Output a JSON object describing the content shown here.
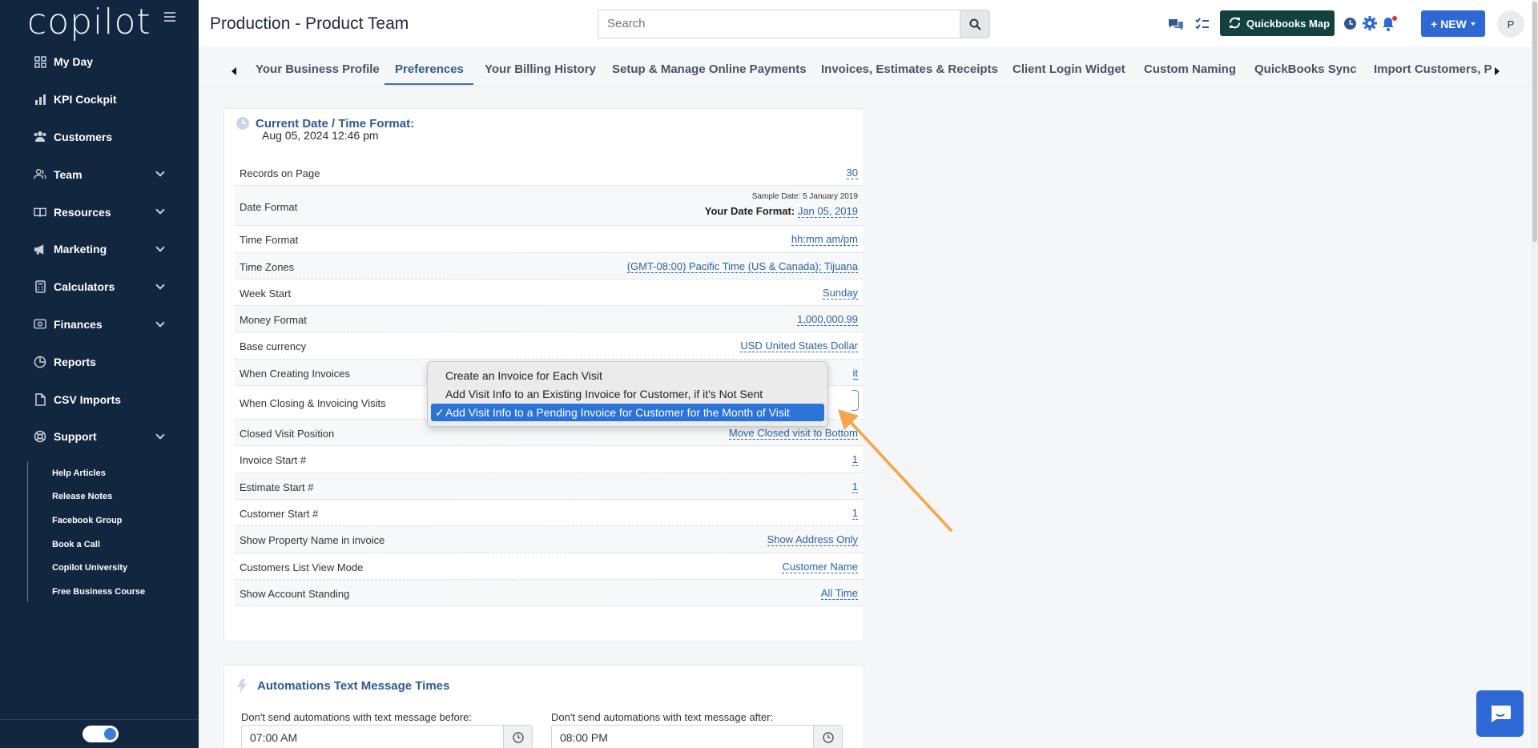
{
  "app": {
    "logo": "copilot"
  },
  "sidebar": {
    "items": [
      {
        "label": "My Day",
        "icon": "grid-icon"
      },
      {
        "label": "KPI Cockpit",
        "icon": "bar-chart-icon"
      },
      {
        "label": "Customers",
        "icon": "users-icon"
      },
      {
        "label": "Team",
        "icon": "user-group-icon",
        "expandable": true
      },
      {
        "label": "Resources",
        "icon": "book-icon",
        "expandable": true
      },
      {
        "label": "Marketing",
        "icon": "megaphone-icon",
        "expandable": true
      },
      {
        "label": "Calculators",
        "icon": "calculator-icon",
        "expandable": true
      },
      {
        "label": "Finances",
        "icon": "money-icon",
        "expandable": true
      },
      {
        "label": "Reports",
        "icon": "pie-chart-icon"
      },
      {
        "label": "CSV Imports",
        "icon": "file-icon"
      },
      {
        "label": "Support",
        "icon": "lifebuoy-icon",
        "expandable": true
      }
    ],
    "support_items": [
      "Help Articles",
      "Release Notes",
      "Facebook Group",
      "Book a Call",
      "Copilot University",
      "Free Business Course"
    ]
  },
  "header": {
    "title": "Production - Product Team",
    "search_placeholder": "Search",
    "quickbooks_label": "Quickbooks Map",
    "new_label": "+ NEW",
    "avatar_initial": "P"
  },
  "tabs": [
    "Your Business Profile",
    "Preferences",
    "Your Billing History",
    "Setup & Manage Online Payments",
    "Invoices, Estimates & Receipts",
    "Client Login Widget",
    "Custom Naming",
    "QuickBooks Sync",
    "Import Customers, P"
  ],
  "prefs": {
    "title": "Current Date / Time Format:",
    "current_datetime": "Aug 05, 2024 12:46 pm",
    "records_label": "Records on Page",
    "records_value": "30",
    "date_format_label": "Date Format",
    "sample_date": "Sample Date: 5 January 2019",
    "your_date_format_label": "Your Date Format:",
    "your_date_format_value": "Jan 05, 2019",
    "time_format_label": "Time Format",
    "time_format_value": "hh:mm am/pm",
    "time_zones_label": "Time Zones",
    "time_zones_value": "(GMT-08:00) Pacific Time (US & Canada); Tijuana",
    "week_start_label": "Week Start",
    "week_start_value": "Sunday",
    "money_format_label": "Money Format",
    "money_format_value": "1,000,000.99",
    "base_currency_label": "Base currency",
    "base_currency_value": "USD United States Dollar",
    "creating_invoices_label": "When Creating Invoices",
    "creating_invoices_value": "it",
    "closing_invoicing_label": "When Closing & Invoicing Visits",
    "closed_visit_label": "Closed Visit Position",
    "closed_visit_value": "Move Closed visit to Bottom",
    "invoice_start_label": "Invoice Start #",
    "invoice_start_value": "1",
    "estimate_start_label": "Estimate Start #",
    "estimate_start_value": "1",
    "customer_start_label": "Customer Start #",
    "customer_start_value": "1",
    "property_name_label": "Show Property Name in invoice",
    "property_name_value": "Show Address Only",
    "list_view_label": "Customers List View Mode",
    "list_view_value": "Customer Name",
    "account_standing_label": "Show Account Standing",
    "account_standing_value": "All Time"
  },
  "dropdown": {
    "options": [
      "Create an Invoice for Each Visit",
      "Add Visit Info to an Existing Invoice for Customer, if it's Not Sent",
      "Add Visit Info to a Pending Invoice for Customer for the Month of Visit"
    ],
    "selected_index": 2,
    "check": "✓"
  },
  "automations": {
    "title": "Automations Text Message Times",
    "before_label": "Don't send automations with text message before:",
    "before_value": "07:00 AM",
    "after_label": "Don't send automations with text message after:",
    "after_value": "08:00 PM"
  },
  "colors": {
    "sidebar_bg": "#12263f",
    "accent": "#2d68d4",
    "link": "#2b62a8",
    "annotation_arrow": "#f5a54a"
  }
}
